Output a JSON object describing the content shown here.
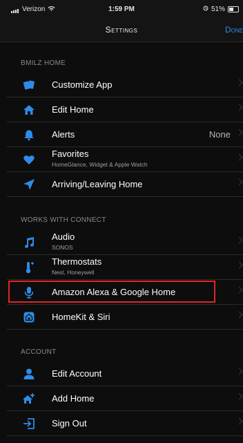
{
  "status": {
    "carrier": "Verizon",
    "time": "1:59 PM",
    "battery": "51%",
    "battery_level": 0.51
  },
  "nav": {
    "title": "Settings",
    "done_label": "Done"
  },
  "sections": {
    "home": {
      "header": "BMILZ HOME",
      "items": [
        {
          "label": "Customize App",
          "icon": "cards-icon"
        },
        {
          "label": "Edit Home",
          "icon": "house-icon"
        },
        {
          "label": "Alerts",
          "value": "None",
          "icon": "bell-icon"
        },
        {
          "label": "Favorites",
          "sub": "HomeGlance, Widget & Apple Watch",
          "icon": "heart-icon"
        },
        {
          "label": "Arriving/Leaving Home",
          "icon": "location-arrow-icon"
        }
      ]
    },
    "works": {
      "header": "WORKS WITH CONNECT",
      "items": [
        {
          "label": "Audio",
          "sub": "SONOS",
          "icon": "music-note-icon"
        },
        {
          "label": "Thermostats",
          "sub": "Nest, Honeywell",
          "icon": "thermometer-icon"
        },
        {
          "label": "Amazon Alexa & Google Home",
          "icon": "microphone-icon"
        },
        {
          "label": "HomeKit & Siri",
          "icon": "homekit-icon"
        }
      ]
    },
    "account": {
      "header": "ACCOUNT",
      "items": [
        {
          "label": "Edit Account",
          "icon": "person-icon"
        },
        {
          "label": "Add Home",
          "icon": "add-home-icon"
        },
        {
          "label": "Sign Out",
          "icon": "sign-out-icon"
        }
      ]
    }
  },
  "colors": {
    "accent": "#2f8be6",
    "highlight": "#e02626",
    "background": "#0d0d0d"
  }
}
